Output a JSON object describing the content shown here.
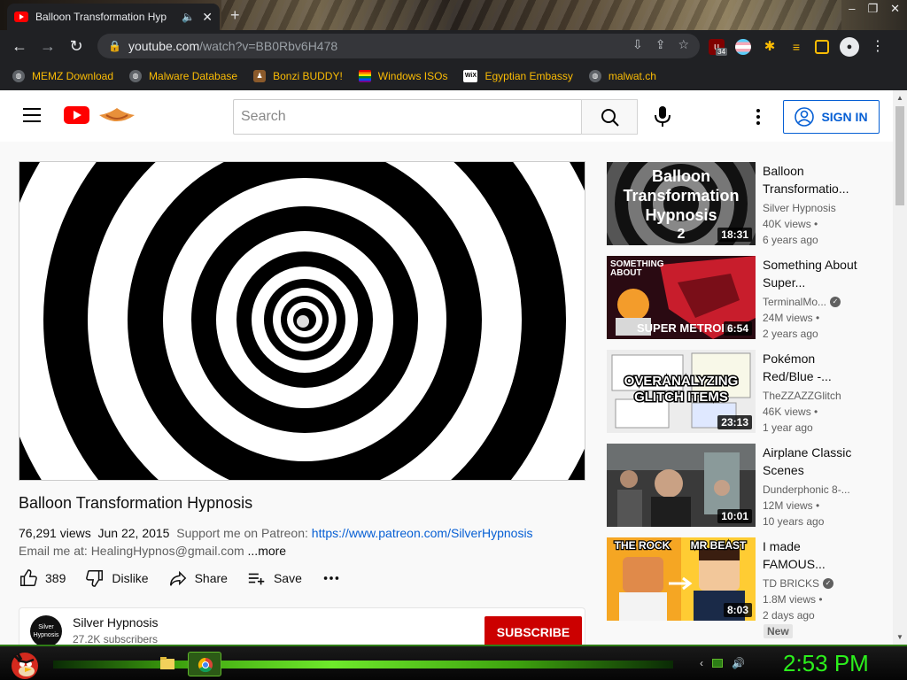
{
  "browser": {
    "tab_title": "Balloon Transformation Hyp",
    "url_host": "youtube.com",
    "url_path": "/watch?v=BB0Rbv6H478",
    "extension_badge": "34",
    "new_tab_glyph": "+",
    "window_controls": [
      "–",
      "❐",
      "✕"
    ],
    "bookmarks": [
      {
        "label": "MEMZ Download",
        "icon": "globe-icon"
      },
      {
        "label": "Malware Database",
        "icon": "globe-icon"
      },
      {
        "label": "Bonzi BUDDY!",
        "icon": "bonzi-icon"
      },
      {
        "label": "Windows ISOs",
        "icon": "windows-flag-icon"
      },
      {
        "label": "Egyptian Embassy",
        "icon": "wix-icon"
      },
      {
        "label": "malwat.ch",
        "icon": "globe-icon"
      }
    ],
    "wix_text": "WiX"
  },
  "youtube": {
    "search_placeholder": "Search",
    "sign_in_label": "SIGN IN"
  },
  "video": {
    "title": "Balloon Transformation Hypnosis",
    "views": "76,291 views",
    "date": "Jun 22, 2015",
    "desc_prefix": "Support me on Patreon:",
    "patreon_link": "https://www.patreon.com/SilverHypnosis",
    "email_line": "Email me at: HealingHypnos@gmail.com",
    "more_label": "...more",
    "likes": "389",
    "dislike_label": "Dislike",
    "share_label": "Share",
    "save_label": "Save",
    "channel_name": "Silver Hypnosis",
    "channel_avatar_text": "Silver Hypnosis",
    "subscribers": "27.2K subscribers",
    "subscribe_label": "SUBSCRIBE"
  },
  "recommendations": [
    {
      "title": "Balloon Transformatio...",
      "channel": "Silver Hypnosis",
      "verified": false,
      "views": "40K views •",
      "age": "6 years ago",
      "duration": "18:31",
      "thumb_text": "Balloon Transformation Hypnosis 2",
      "thumb_lines": [
        "Balloon",
        "Transformation",
        "Hypnosis",
        "2"
      ]
    },
    {
      "title": "Something About Super...",
      "channel": "TerminalMo...",
      "verified": true,
      "views": "24M views •",
      "age": "2 years ago",
      "duration": "6:54",
      "thumb_text": "SOMETHING ABOUT SUPER METROID",
      "thumb_lines": [
        "SOMETHING",
        "ABOUT",
        "SUPER METROID"
      ]
    },
    {
      "title": "Pokémon Red/Blue -...",
      "channel": "TheZZAZZGlitch",
      "verified": false,
      "views": "46K views •",
      "age": "1 year ago",
      "duration": "23:13",
      "thumb_text": "OVERANALYZING GLITCH ITEMS",
      "thumb_lines": [
        "OVERANALYZING",
        "GLITCH ITEMS"
      ]
    },
    {
      "title": "Airplane Classic Scenes",
      "channel": "Dunderphonic 8-...",
      "verified": false,
      "views": "12M views •",
      "age": "10 years ago",
      "duration": "10:01",
      "thumb_text": "",
      "thumb_lines": []
    },
    {
      "title": "I made FAMOUS...",
      "channel": "TD BRICKS",
      "verified": true,
      "views": "1.8M views •",
      "age": "2 days ago",
      "duration": "8:03",
      "thumb_text": "THE ROCK MR BEAST",
      "thumb_lines": [
        "THE ROCK",
        "MR BEAST"
      ],
      "badge": "New"
    }
  ],
  "taskbar": {
    "clock": "2:53 PM"
  },
  "colors": {
    "youtube_red": "#ff0000",
    "link_blue": "#065fd4",
    "subscribe_red": "#cc0000",
    "bookmark_text": "#fbbc04",
    "clock_green": "#2cf01c"
  }
}
